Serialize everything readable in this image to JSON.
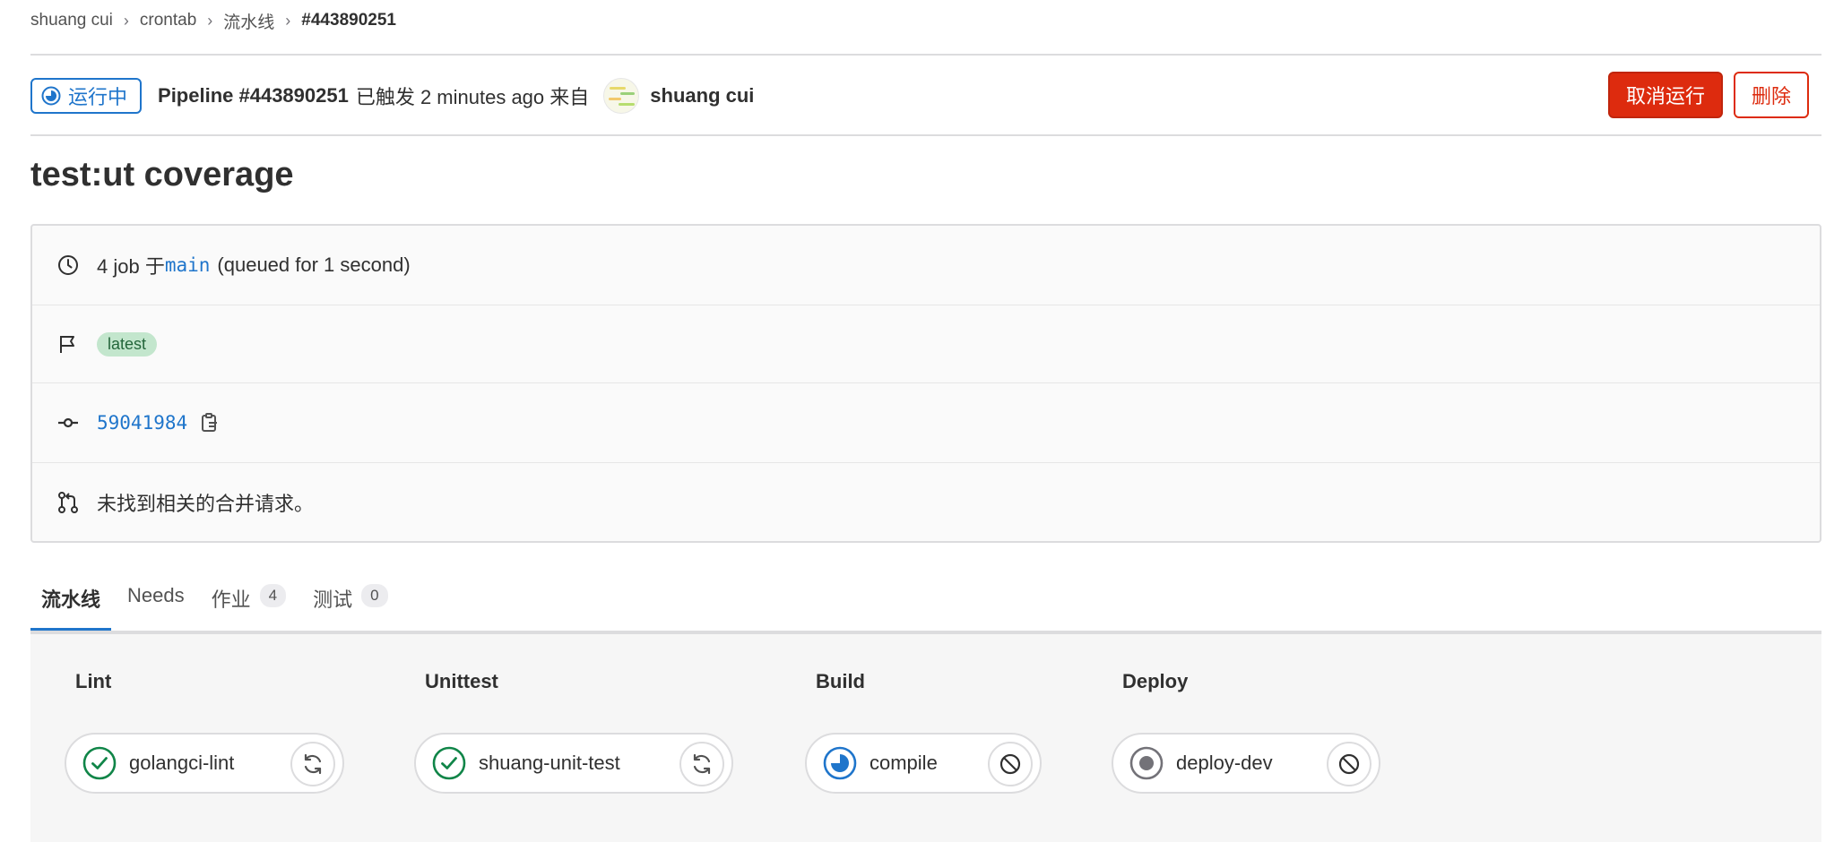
{
  "breadcrumb": {
    "items": [
      "shuang cui",
      "crontab",
      "流水线",
      "#443890251"
    ],
    "separator": "›"
  },
  "header": {
    "status_label": "运行中",
    "pipeline_id": "Pipeline #443890251",
    "triggered_text": "已触发 2 minutes ago 来自",
    "user_name": "shuang cui",
    "cancel_label": "取消运行",
    "delete_label": "删除"
  },
  "title": "test:ut coverage",
  "info": {
    "jobs_prefix": "4 job 于",
    "branch": "main",
    "queued": "(queued for 1 second)",
    "badge": "latest",
    "commit_sha": "59041984",
    "mr_text": "未找到相关的合并请求。"
  },
  "tabs": [
    {
      "label": "流水线",
      "count": null,
      "active": true
    },
    {
      "label": "Needs",
      "count": null,
      "active": false
    },
    {
      "label": "作业",
      "count": "4",
      "active": false
    },
    {
      "label": "测试",
      "count": "0",
      "active": false
    }
  ],
  "stages": [
    {
      "name": "Lint",
      "job": "golangci-lint",
      "status": "success",
      "action": "retry"
    },
    {
      "name": "Unittest",
      "job": "shuang-unit-test",
      "status": "success",
      "action": "retry"
    },
    {
      "name": "Build",
      "job": "compile",
      "status": "running",
      "action": "cancel"
    },
    {
      "name": "Deploy",
      "job": "deploy-dev",
      "status": "created",
      "action": "cancel"
    }
  ],
  "icons": {
    "status_running": "running-icon",
    "clock": "clock-icon",
    "flag": "flag-icon",
    "commit": "commit-icon",
    "copy": "copy-icon",
    "merge_request": "merge-request-icon",
    "success": "check-circle-icon",
    "retry": "retry-icon",
    "cancel": "cancel-icon",
    "created": "created-icon"
  },
  "colors": {
    "accent": "#1f75cb",
    "danger": "#dd2b0e",
    "success": "#108548",
    "badge_bg": "#c3e6cd",
    "badge_text": "#24663b"
  }
}
